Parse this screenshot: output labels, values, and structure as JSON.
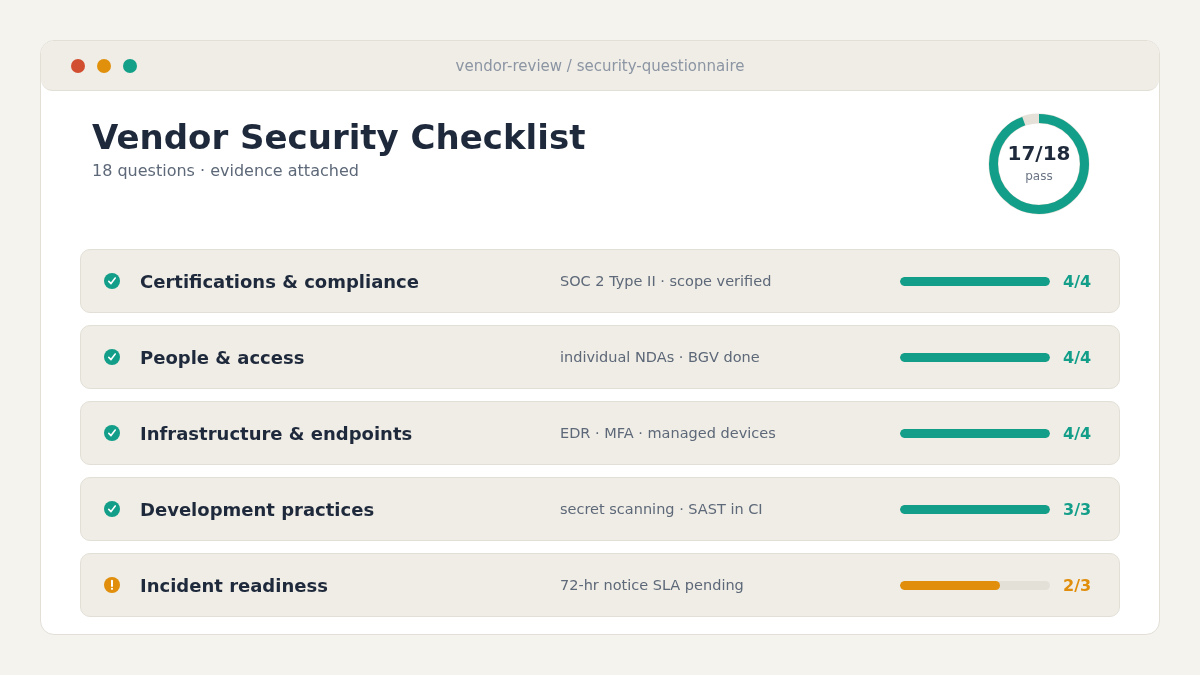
{
  "window": {
    "title": "vendor-review / security-questionnaire"
  },
  "header": {
    "title": "Vendor Security Checklist",
    "subtitle": "18 questions · evidence attached"
  },
  "summary": {
    "score": "17/18",
    "label": "pass",
    "level": 0.944
  },
  "sections": [
    {
      "title": "Certifications & compliance",
      "detail": "SOC 2 Type II · scope verified",
      "complete": true,
      "level": 1,
      "score": "4/4"
    },
    {
      "title": "People & access",
      "detail": "individual NDAs · BGV done",
      "complete": true,
      "level": 1,
      "score": "4/4"
    },
    {
      "title": "Infrastructure & endpoints",
      "detail": "EDR · MFA · managed devices",
      "complete": true,
      "level": 1,
      "score": "4/4"
    },
    {
      "title": "Development practices",
      "detail": "secret scanning · SAST in CI",
      "complete": true,
      "level": 1,
      "score": "3/3"
    },
    {
      "title": "Incident readiness",
      "detail": "72-hr notice SLA pending",
      "complete": false,
      "level": 0.667,
      "score": "2/3"
    }
  ]
}
